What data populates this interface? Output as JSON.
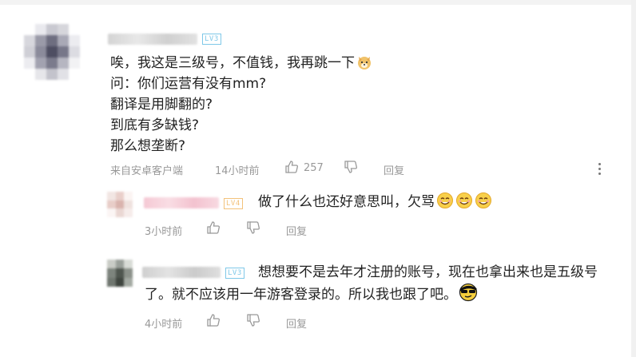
{
  "comment": {
    "level": "LV3",
    "lines": [
      "唉，我这是三级号，不值钱，我再跳一下",
      "问：你们运营有没有mm?",
      "翻译是用脚翻的?",
      "到底有多缺钱?",
      "那么想垄断?"
    ],
    "source": "来自安卓客户端",
    "time": "14小时前",
    "likes": "257",
    "reply_label": "回复",
    "emoji": "doge-emoji"
  },
  "replies": [
    {
      "level": "LV4",
      "text": "做了什么也还好意思叫，欠骂",
      "emojis": [
        "smile-emoji",
        "smile-emoji",
        "smile-emoji"
      ],
      "time": "3小时前",
      "reply_label": "回复"
    },
    {
      "level": "LV3",
      "lines": [
        "想想要不是去年才注册的账号，现在也拿出来也是五级号",
        "了。就不应该用一年游客登录的。所以我也跟了吧。"
      ],
      "emoji": "sunglasses-emoji",
      "time": "4小时前",
      "reply_label": "回复"
    }
  ],
  "colors": {
    "text": "#222222",
    "meta": "#999999",
    "lv3": "#7fc8e8",
    "lv4": "#f3c27a"
  }
}
